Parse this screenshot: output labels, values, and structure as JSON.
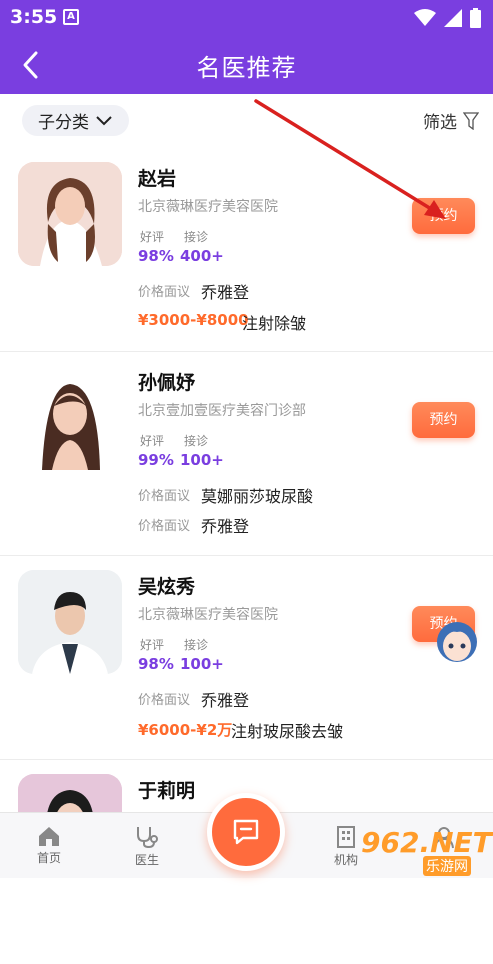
{
  "status_bar": {
    "time": "3:55",
    "app_icon_letter": "A"
  },
  "header": {
    "title": "名医推荐"
  },
  "filter_bar": {
    "subcategory_label": "子分类",
    "filter_label": "筛选"
  },
  "labels": {
    "rating": "好评",
    "consult": "接诊",
    "price_label": "价格面议"
  },
  "doctors": [
    {
      "name": "赵岩",
      "hospital": "北京薇琳医疗美容医院",
      "rating": "98%",
      "consult": "400+",
      "specialist": "乔雅登",
      "price": "¥3000-¥8000",
      "service": "注射除皱",
      "book_label": "预约"
    },
    {
      "name": "孙佩妤",
      "hospital": "北京壹加壹医疗美容门诊部",
      "rating": "99%",
      "consult": "100+",
      "specialist": "莫娜丽莎玻尿酸",
      "second_specialist": "乔雅登",
      "book_label": "预约"
    },
    {
      "name": "吴炫秀",
      "hospital": "北京薇琳医疗美容医院",
      "rating": "98%",
      "consult": "100+",
      "specialist": "乔雅登",
      "price": "¥6000-¥2万",
      "service": "注射玻尿酸去皱",
      "book_label": "预约"
    },
    {
      "name": "于莉明"
    }
  ],
  "tab_bar": {
    "home": "首页",
    "doctor": "医生",
    "institution": "机构"
  },
  "watermark": {
    "main": "962.NET",
    "sub": "乐游网"
  },
  "colors": {
    "primary": "#7a3ee0",
    "accent": "#ff6b3d",
    "arrow": "#d9211f"
  }
}
